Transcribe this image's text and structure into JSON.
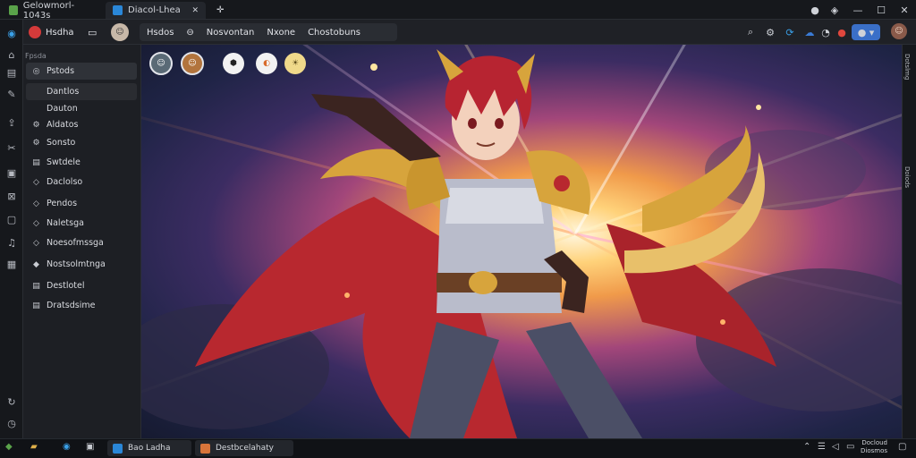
{
  "titlebar": {
    "app_title": "Gelowmorl-1043s",
    "tabs": [
      {
        "label": "Diacol-Lhea",
        "active": true
      },
      {
        "label": "✕",
        "active": false
      }
    ],
    "window_controls": [
      "minimize",
      "maximize",
      "close"
    ]
  },
  "toolbar": {
    "app_name": "Hsdha",
    "items": [
      "Hsdos",
      "Nosvontan",
      "Nxone",
      "Chostobuns"
    ]
  },
  "sidebar": {
    "header": "Fpsda",
    "items": [
      {
        "label": "Pstods",
        "icon": "circle-icon"
      },
      {
        "label": "Dantlos",
        "icon": "square-icon"
      },
      {
        "label": "Dauton",
        "icon": "dot-icon"
      },
      {
        "label": "Aldatos",
        "icon": "gear-icon"
      },
      {
        "label": "Sonsto",
        "icon": "gear-icon"
      },
      {
        "label": "Swtdele",
        "icon": "doc-icon"
      },
      {
        "label": "Daclolso",
        "icon": "shield-icon"
      },
      {
        "label": "Pendos",
        "icon": "shield-icon"
      },
      {
        "label": "Naletsga",
        "icon": "shield-icon"
      },
      {
        "label": "Noesofmssga",
        "icon": "shield-icon"
      },
      {
        "label": "Nostsolmtnga",
        "icon": "diamond-icon"
      },
      {
        "label": "Destlotel",
        "icon": "doc-icon"
      },
      {
        "label": "Dratsdsime",
        "icon": "doc-icon"
      }
    ]
  },
  "canvas": {
    "top_icons": [
      "avatar-1",
      "avatar-2",
      "cube-icon",
      "badge-icon",
      "sun-icon"
    ]
  },
  "right_rail": {
    "label_top": "Dotslmg",
    "label_mid": "Doiods"
  },
  "taskbar": {
    "tasks": [
      {
        "label": "Bao Ladha",
        "open": true
      },
      {
        "label": "Destbcelahaty",
        "open": true
      }
    ],
    "clock_top": "Docloud",
    "clock_bottom": "Diosmos"
  },
  "colors": {
    "accent": "#3a7bd5",
    "sidebar_bg": "#1d1f24",
    "hero_red": "#b8282f",
    "gold": "#d7a43c"
  }
}
